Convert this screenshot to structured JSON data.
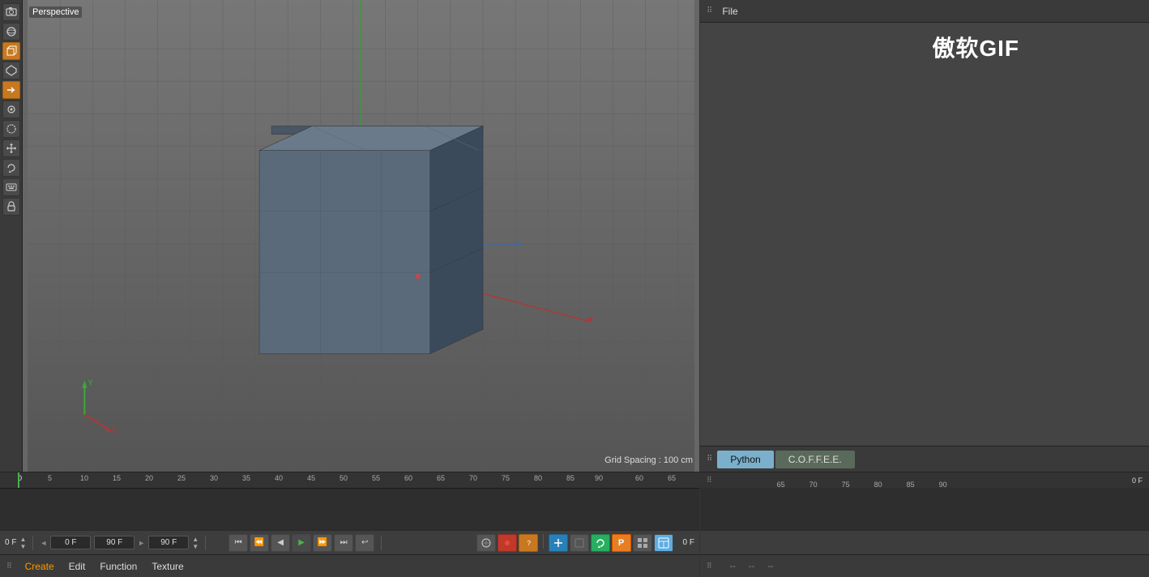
{
  "viewport": {
    "perspective_label": "Perspective",
    "grid_spacing": "Grid Spacing : 100 cm"
  },
  "watermark": {
    "text": "傲软GIF"
  },
  "properties_panel": {
    "header_menu": "File"
  },
  "script_tabs": [
    {
      "id": "python",
      "label": "Python",
      "active": true
    },
    {
      "id": "coffee",
      "label": "C.O.F.F.E.E.",
      "active": false
    }
  ],
  "timeline": {
    "current_frame": "0",
    "current_frame_display": "0 F",
    "start_frame": "0 F",
    "end_frame": "90 F",
    "end_frame2": "90 F",
    "frame_counter": "0 F",
    "ruler_ticks": [
      "0",
      "5",
      "10",
      "15",
      "20",
      "25",
      "30",
      "35",
      "40",
      "45",
      "50",
      "55",
      "60",
      "65",
      "70",
      "75",
      "80",
      "85",
      "90"
    ],
    "right_frame_label": "0 F"
  },
  "bottom_menu": {
    "items": [
      "Create",
      "Edit",
      "Function",
      "Texture"
    ]
  },
  "right_bottom": {
    "col1": "--",
    "col2": "--",
    "col3": "--"
  },
  "toolbar": {
    "buttons": [
      {
        "name": "camera-icon",
        "symbol": "📷"
      },
      {
        "name": "sphere-icon",
        "symbol": "●"
      },
      {
        "name": "cube-icon",
        "symbol": "■"
      },
      {
        "name": "poly-icon",
        "symbol": "◆"
      },
      {
        "name": "arrow-icon",
        "symbol": "▶"
      },
      {
        "name": "cursor-icon",
        "symbol": "↖"
      },
      {
        "name": "select-icon",
        "symbol": "○"
      },
      {
        "name": "move-icon",
        "symbol": "↔"
      },
      {
        "name": "rotate-icon",
        "symbol": "↺"
      },
      {
        "name": "keyboard-icon",
        "symbol": "⌨"
      },
      {
        "name": "lock-icon",
        "symbol": "🔒"
      }
    ]
  }
}
